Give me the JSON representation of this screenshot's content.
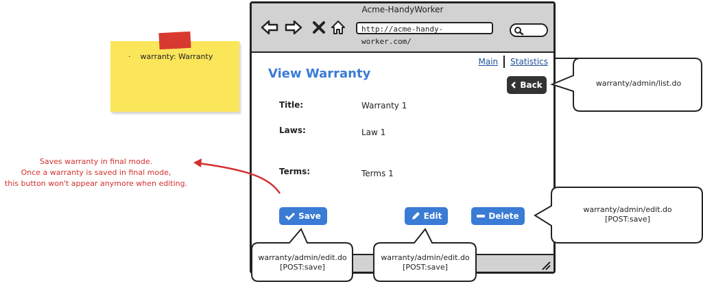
{
  "sticky_note": {
    "bullet": "·",
    "item": "warranty: Warranty"
  },
  "browser": {
    "title": "Acme-HandyWorker",
    "url": "http://acme-handy-worker.com/"
  },
  "menu": {
    "main": "Main",
    "statistics": "Statistics"
  },
  "page": {
    "title": "View Warranty",
    "back_label": "Back",
    "fields": [
      {
        "label": "Title:",
        "value": "Warranty 1"
      },
      {
        "label": "Laws:",
        "value": "Law 1"
      },
      {
        "label": "Terms:",
        "value": "Terms 1"
      }
    ]
  },
  "buttons": {
    "save": "Save",
    "edit": "Edit",
    "delete": "Delete"
  },
  "callouts": {
    "back": "warranty/admin/list.do",
    "delete": [
      "warranty/admin/edit.do",
      "[POST:save]"
    ],
    "save": [
      "warranty/admin/edit.do",
      "[POST:save]"
    ],
    "edit": [
      "warranty/admin/edit.do",
      "[POST:save]"
    ]
  },
  "annotation": [
    "Saves warranty in final mode.",
    "Once a warranty is saved in final mode,",
    "this button won't appear anymore when editing."
  ],
  "colors": {
    "accent": "#3a7bd5",
    "annotation": "#d32f2f",
    "sticky": "#fbe65a",
    "tape": "#d83a32"
  },
  "icons": [
    "back-arrow-icon",
    "forward-arrow-icon",
    "close-icon",
    "home-icon",
    "search-icon",
    "chevron-left-icon",
    "check-icon",
    "pencil-icon",
    "minus-icon",
    "resize-grip-icon"
  ]
}
